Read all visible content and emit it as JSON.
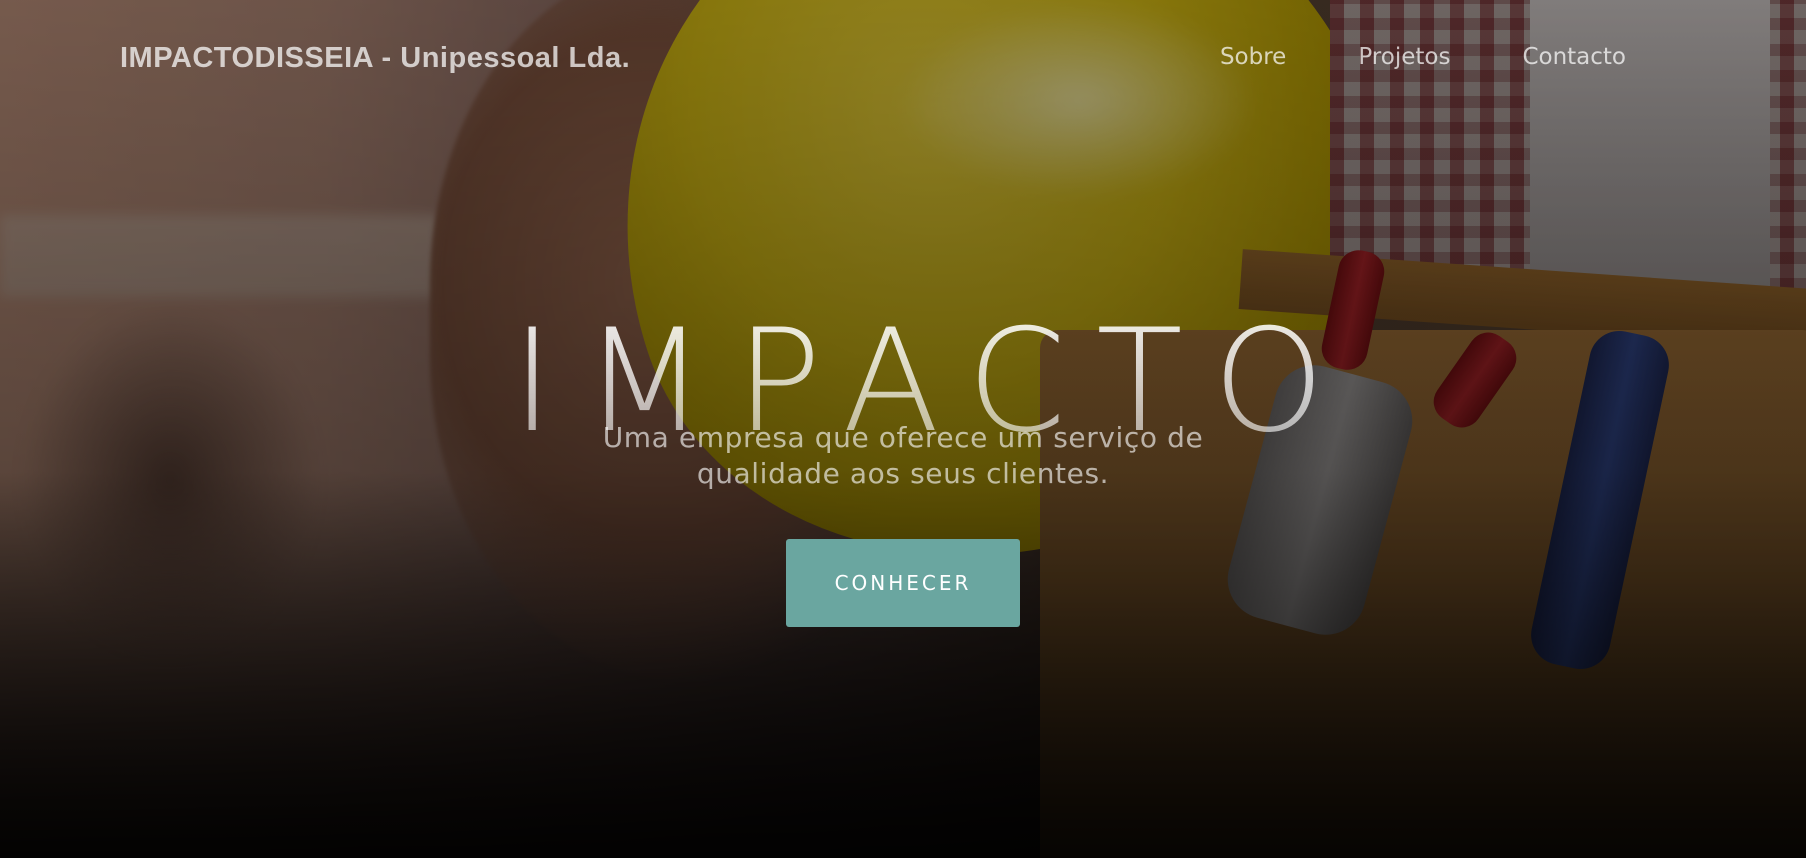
{
  "header": {
    "brand": "IMPACTODISSEIA - Unipessoal Lda.",
    "nav": [
      "Sobre",
      "Projetos",
      "Contacto"
    ]
  },
  "hero": {
    "title": "IMPACTO",
    "subtitle": "Uma empresa que oferece um serviço de qualidade aos seus clientes.",
    "cta_label": "CONHECER",
    "background_description": "worker holding yellow hard hat with tool belt"
  },
  "colors": {
    "accent": "#6aa6a0",
    "text": "#ffffff",
    "helmet": "#d4bd12"
  }
}
